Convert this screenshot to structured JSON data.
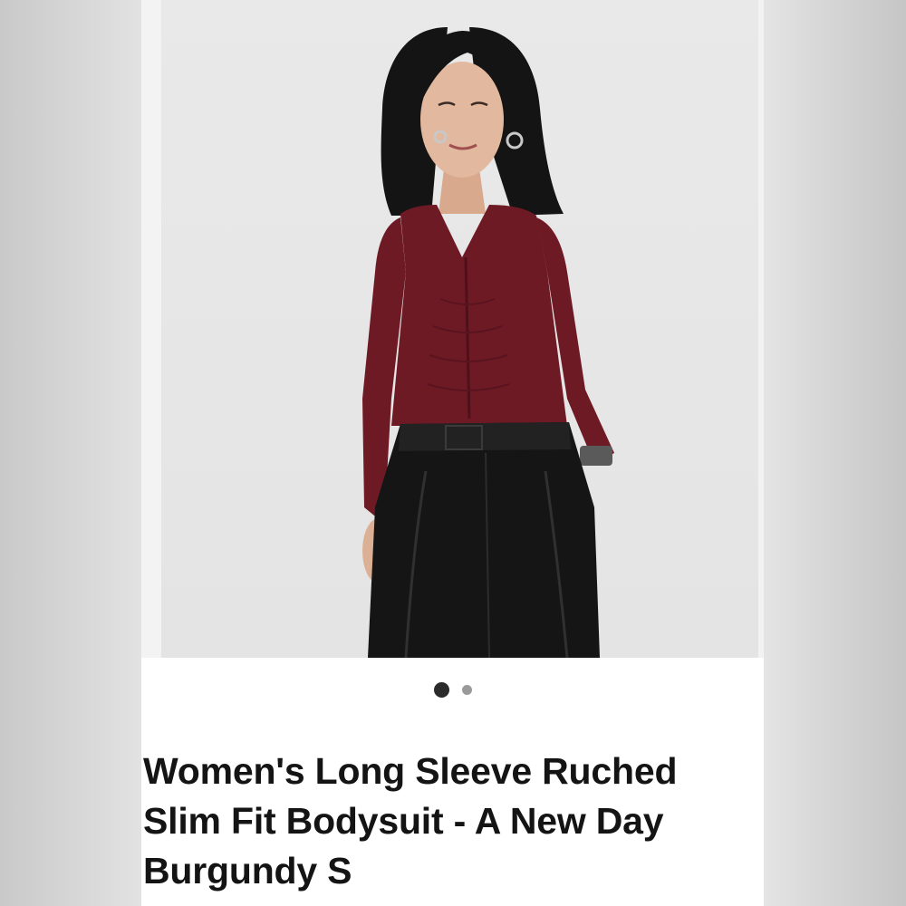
{
  "product": {
    "title": "Women's Long Sleeve Ruched Slim Fit Bodysuit - A New Day Burgundy S",
    "image_alt": "Woman wearing burgundy ruched long sleeve bodysuit with black trousers"
  },
  "carousel": {
    "total_images": 2,
    "current_index": 1
  },
  "colors": {
    "bodysuit": "#6e1a25",
    "trousers": "#151515",
    "dot_active": "#2b2b2b",
    "dot_inactive": "#9a9a9a"
  }
}
